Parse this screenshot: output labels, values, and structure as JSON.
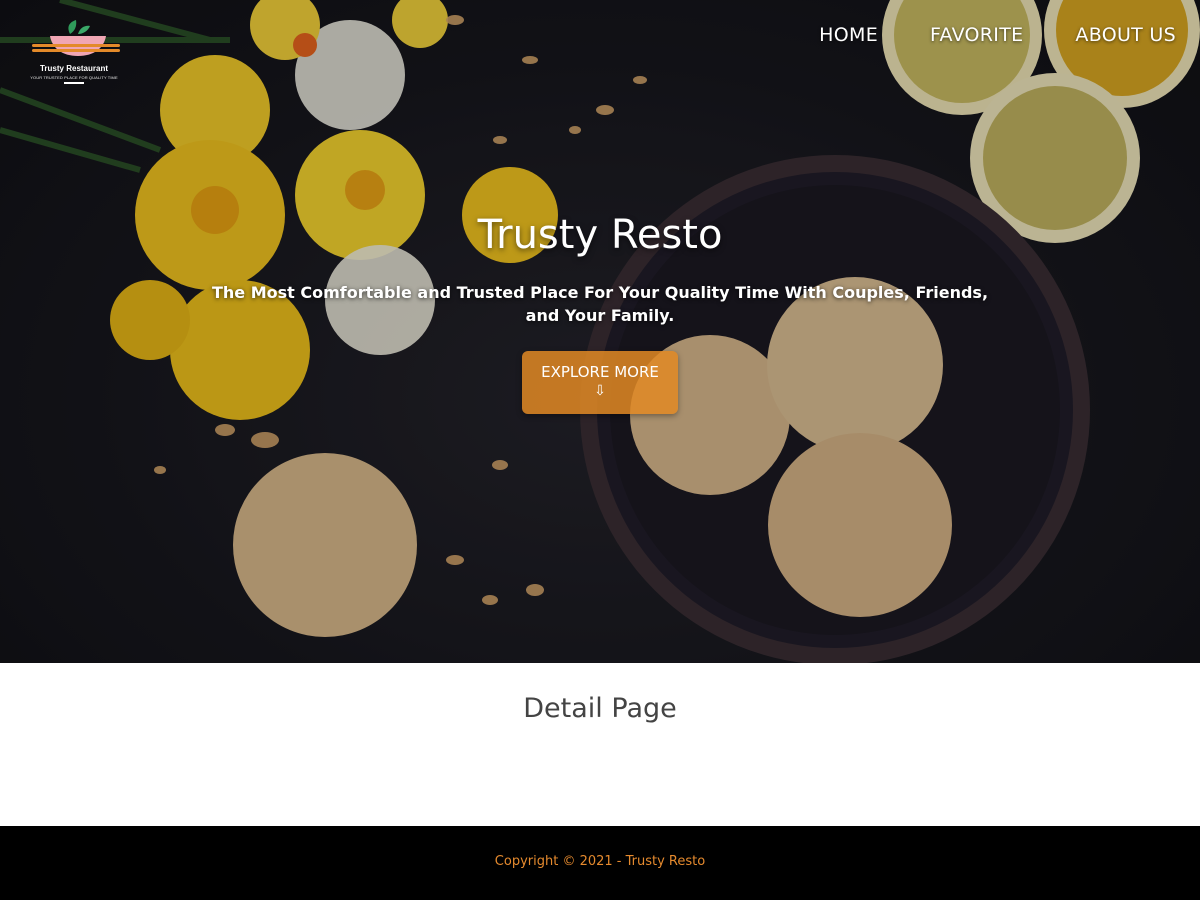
{
  "brand": {
    "logo_name": "Trusty Restaurant",
    "logo_tagline": "YOUR TRUSTED PLACE FOR QUALITY TIME"
  },
  "nav": {
    "items": [
      {
        "label": "HOME"
      },
      {
        "label": "FAVORITE"
      },
      {
        "label": "ABOUT US"
      }
    ]
  },
  "hero": {
    "title": "Trusty Resto",
    "subtitle": "The Most Comfortable and Trusted Place For Your Quality Time With Couples, Friends, and Your Family.",
    "cta_label": "EXPLORE MORE",
    "cta_arrow": "⇩",
    "cta_icon": "down-arrow-icon"
  },
  "main": {
    "title": "Detail Page"
  },
  "footer": {
    "copyright": "Copyright © 2021 - Trusty Resto"
  },
  "colors": {
    "accent": "#e28a24",
    "footer_bg": "#000000",
    "footer_text": "#e58a2e",
    "heading": "#444444"
  }
}
